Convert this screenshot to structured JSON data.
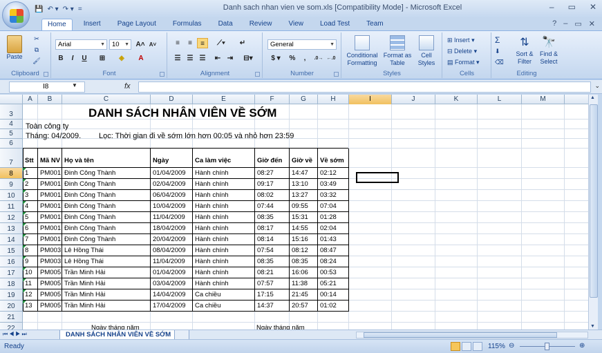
{
  "window": {
    "title": "Danh sach nhan vien ve som.xls  [Compatibility Mode] - Microsoft Excel",
    "min": "–",
    "max": "▭",
    "close": "✕"
  },
  "qat": {
    "save": "💾",
    "undo": "↶ ▾",
    "redo": "↷ ▾",
    "more": "="
  },
  "tabs": [
    "Home",
    "Insert",
    "Page Layout",
    "Formulas",
    "Data",
    "Review",
    "View",
    "Load Test",
    "Team"
  ],
  "ribbon": {
    "clipboard": {
      "label": "Clipboard",
      "paste": "Paste"
    },
    "font": {
      "label": "Font",
      "name": "Arial",
      "size": "10",
      "bold": "B",
      "italic": "I",
      "underline": "U",
      "grow": "A˄",
      "shrink": "A˅"
    },
    "alignment": {
      "label": "Alignment"
    },
    "number": {
      "label": "Number",
      "format": "General",
      "currency": "$",
      "percent": "%",
      "comma": ","
    },
    "styles": {
      "label": "Styles",
      "conditional": "Conditional Formatting",
      "format_table": "Format as Table",
      "cell_styles": "Cell Styles"
    },
    "cells": {
      "label": "Cells",
      "insert": "Insert",
      "delete": "Delete",
      "format": "Format"
    },
    "editing": {
      "label": "Editing",
      "sort": "Sort & Filter",
      "find": "Find & Select",
      "sum": "Σ"
    }
  },
  "formula": {
    "namebox": "I8",
    "fx": "fx",
    "value": ""
  },
  "columns": [
    "A",
    "B",
    "C",
    "D",
    "E",
    "F",
    "G",
    "H",
    "I",
    "J",
    "K",
    "L",
    "M"
  ],
  "rows": [
    "3",
    "4",
    "5",
    "6",
    "7",
    "8",
    "9",
    "10",
    "11",
    "12",
    "13",
    "14",
    "15",
    "16",
    "17",
    "18",
    "19",
    "20",
    "21",
    "22"
  ],
  "sheet": {
    "title": "DANH SÁCH NHÂN VIÊN VỀ SỚM",
    "scope": "Toàn công ty",
    "period": "Tháng: 04/2009.",
    "filter": "Lọc: Thời gian đi về sớm lớn hơn 00:05 và nhỏ hơn 23:59",
    "headers": [
      "Stt",
      "Mã NV",
      "Họ và tên",
      "Ngày",
      "Ca làm việc",
      "Giờ đến",
      "Giờ về",
      "Về sớm"
    ],
    "data": [
      [
        "1",
        "PM001",
        "Đinh Công Thành",
        "01/04/2009",
        "Hành chính",
        "08:27",
        "14:47",
        "02:12"
      ],
      [
        "2",
        "PM001",
        "Đinh Công Thành",
        "02/04/2009",
        "Hành chính",
        "09:17",
        "13:10",
        "03:49"
      ],
      [
        "3",
        "PM001",
        "Đinh Công Thành",
        "06/04/2009",
        "Hành chính",
        "08:02",
        "13:27",
        "03:32"
      ],
      [
        "4",
        "PM001",
        "Đinh Công Thành",
        "10/04/2009",
        "Hành chính",
        "07:44",
        "09:55",
        "07:04"
      ],
      [
        "5",
        "PM001",
        "Đinh Công Thành",
        "11/04/2009",
        "Hành chính",
        "08:35",
        "15:31",
        "01:28"
      ],
      [
        "6",
        "PM001",
        "Đinh Công Thành",
        "18/04/2009",
        "Hành chính",
        "08:17",
        "14:55",
        "02:04"
      ],
      [
        "7",
        "PM001",
        "Đinh Công Thành",
        "20/04/2009",
        "Hành chính",
        "08:14",
        "15:16",
        "01:43"
      ],
      [
        "8",
        "PM003",
        "Lê Hồng Thái",
        "08/04/2009",
        "Hành chính",
        "07:54",
        "08:12",
        "08:47"
      ],
      [
        "9",
        "PM003",
        "Lê Hồng Thái",
        "11/04/2009",
        "Hành chính",
        "08:35",
        "08:35",
        "08:24"
      ],
      [
        "10",
        "PM005",
        "Trần Minh Hải",
        "01/04/2009",
        "Hành chính",
        "08:21",
        "16:06",
        "00:53"
      ],
      [
        "11",
        "PM005",
        "Trần Minh Hải",
        "03/04/2009",
        "Hành chính",
        "07:57",
        "11:38",
        "05:21"
      ],
      [
        "12",
        "PM005",
        "Trần Minh Hải",
        "14/04/2009",
        "Ca chiều",
        "17:15",
        "21:45",
        "00:14"
      ],
      [
        "13",
        "PM005",
        "Trần Minh Hải",
        "17/04/2009",
        "Ca chiều",
        "14:37",
        "20:57",
        "01:02"
      ]
    ],
    "footer_left": "Ngày    tháng    năm",
    "footer_right": "Ngày    tháng    năm"
  },
  "sheet_tab": "DANH SÁCH NHÂN VIÊN VỀ SỚM",
  "status": {
    "ready": "Ready",
    "zoom": "115%"
  }
}
